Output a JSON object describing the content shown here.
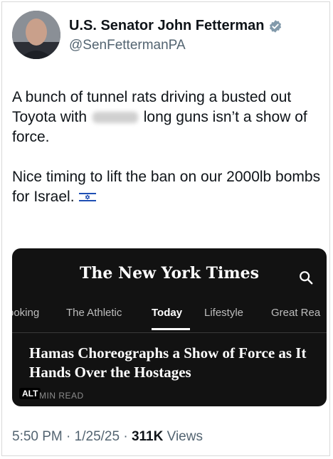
{
  "author": {
    "name": "U.S. Senator John Fetterman",
    "handle": "@SenFettermanPA",
    "verified_color": "#829aab"
  },
  "tweet": {
    "line1_before": "A bunch of tunnel rats driving a busted out Toyota with",
    "line1_after": "long guns isn’t a show of force.",
    "line2": "Nice timing to lift the ban on our 2000lb bombs for Israel."
  },
  "card": {
    "masthead": "The New York Times",
    "nav": [
      {
        "label": "ooking",
        "active": false
      },
      {
        "label": "The Athletic",
        "active": false
      },
      {
        "label": "Today",
        "active": true
      },
      {
        "label": "Lifestyle",
        "active": false
      },
      {
        "label": "Great Rea",
        "active": false
      }
    ],
    "headline": "Hamas Choreographs a Show of Force as It Hands Over the Hostages",
    "alt_badge": "ALT",
    "read_time": "MIN READ"
  },
  "meta": {
    "time": "5:50 PM",
    "date": "1/25/25",
    "separator": "·",
    "views_count": "311K",
    "views_label": "Views"
  }
}
